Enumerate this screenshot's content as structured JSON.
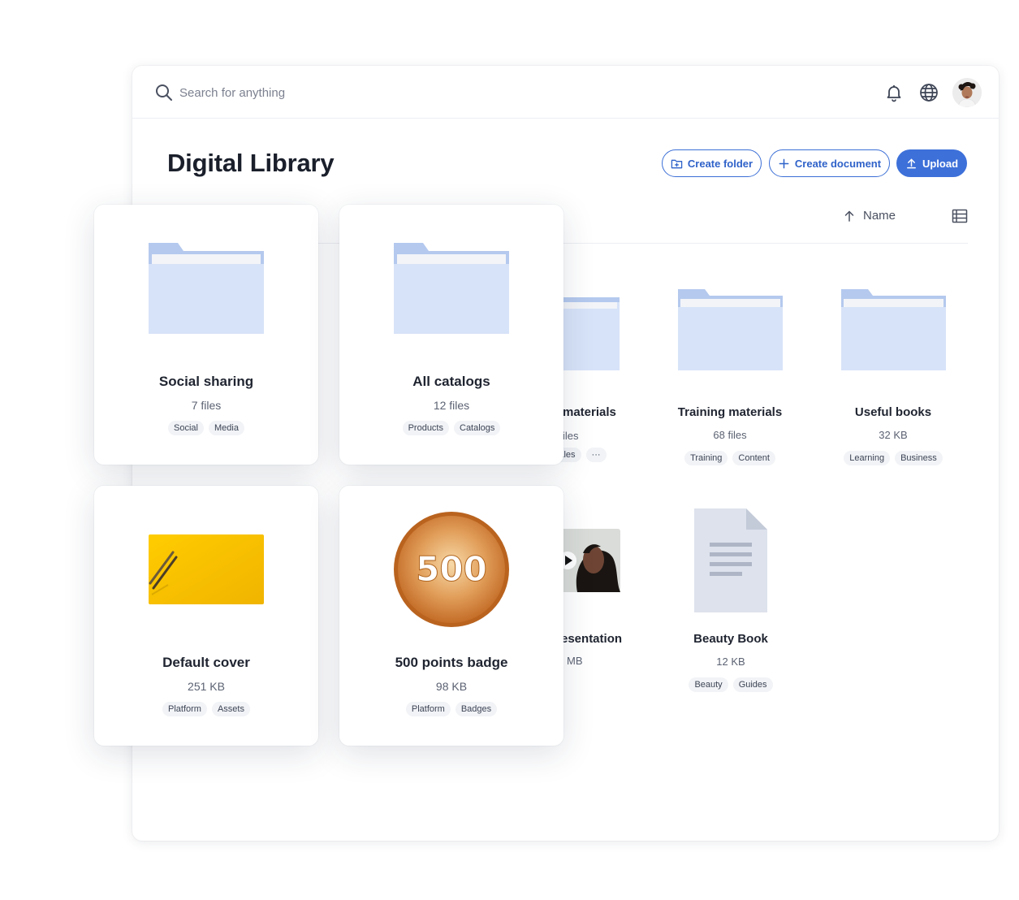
{
  "search": {
    "placeholder": "Search for anything"
  },
  "header": {
    "title": "Digital Library"
  },
  "actions": {
    "create_folder": "Create folder",
    "create_document": "Create document",
    "upload": "Upload"
  },
  "sort": {
    "label": "Name"
  },
  "colors": {
    "accent": "#3d70d9",
    "folder": "#d7e3f8",
    "folder_tab": "#b5c9ee",
    "tag_bg": "#f1f3f6"
  },
  "background_items": [
    {
      "title": "materials",
      "meta": "iles",
      "tags": [
        "Sales",
        "···"
      ]
    },
    {
      "title": "Training materials",
      "meta": "68 files",
      "tags": [
        "Training",
        "Content"
      ]
    },
    {
      "title": "Useful books",
      "meta": "32 KB",
      "tags": [
        "Learning",
        "Business"
      ]
    },
    {
      "title": "esentation",
      "meta": "MB"
    },
    {
      "title": "Beauty Book",
      "meta": "12 KB",
      "tags": [
        "Beauty",
        "Guides"
      ]
    }
  ],
  "cards": [
    {
      "title": "Social sharing",
      "meta": "7 files",
      "tags": [
        "Social",
        "Media"
      ],
      "icon": "folder-icon"
    },
    {
      "title": "All catalogs",
      "meta": "12 files",
      "tags": [
        "Products",
        "Catalogs"
      ],
      "icon": "folder-icon"
    },
    {
      "title": "Default cover",
      "meta": "251 KB",
      "tags": [
        "Platform",
        "Assets"
      ],
      "icon": "cover-image"
    },
    {
      "title": "500 points badge",
      "meta": "98 KB",
      "tags": [
        "Platform",
        "Badges"
      ],
      "icon": "badge-image",
      "badge_text": "500"
    }
  ]
}
